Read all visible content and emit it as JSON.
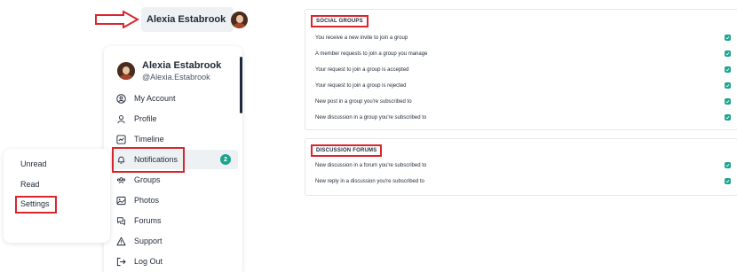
{
  "user": {
    "name": "Alexia Estabrook",
    "handle": "@Alexia.Estabrook"
  },
  "menu": {
    "items": [
      {
        "label": "My Account",
        "icon": "account-circle-icon"
      },
      {
        "label": "Profile",
        "icon": "user-icon"
      },
      {
        "label": "Timeline",
        "icon": "timeline-icon"
      },
      {
        "label": "Notifications",
        "icon": "bell-icon",
        "badge": "2"
      },
      {
        "label": "Groups",
        "icon": "groups-icon"
      },
      {
        "label": "Photos",
        "icon": "photos-icon"
      },
      {
        "label": "Forums",
        "icon": "forums-icon"
      },
      {
        "label": "Support",
        "icon": "warning-icon"
      },
      {
        "label": "Log Out",
        "icon": "logout-icon"
      }
    ]
  },
  "submenu": {
    "items": [
      "Unread",
      "Read",
      "Settings"
    ]
  },
  "social_groups": {
    "title": "SOCIAL GROUPS",
    "rows": [
      "You receive a new invite to join a group",
      "A member requests to join a group you manage",
      "Your request to join a group is accepted",
      "Your request to join a group is rejected",
      "New post in a group you're subscribed to",
      "New discussion in a group you're subscribed to"
    ]
  },
  "discussion_forums": {
    "title": "DISCUSSION FORUMS",
    "rows": [
      "New discussion in a forum you're subscribed to",
      "New reply in a discussion you're subscribed to"
    ]
  },
  "colors": {
    "accent": "#1aa58f",
    "highlight": "#d8262f",
    "hover_bg": "#eef1f4"
  }
}
